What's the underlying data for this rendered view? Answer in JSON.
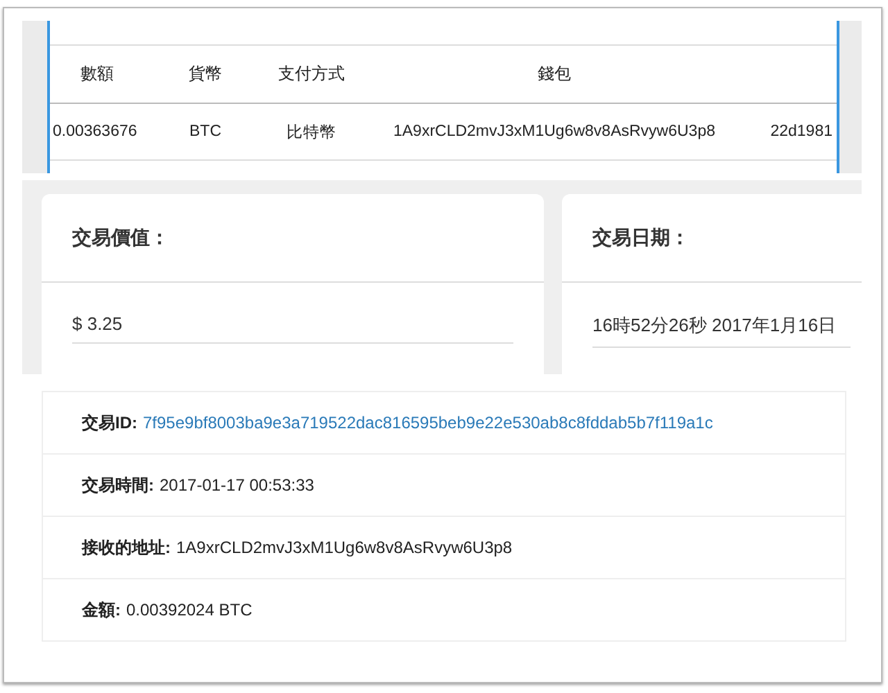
{
  "table": {
    "columns": [
      "數額",
      "貨幣",
      "支付方式",
      "錢包"
    ],
    "rows": [
      [
        "0.00363676",
        "BTC",
        "比特幣",
        "1A9xrCLD2mvJ3xM1Ug6w8v8AsRvyw6U3p8",
        "22d1981"
      ]
    ]
  },
  "cards": [
    {
      "label": "交易價值：",
      "value": "$ 3.25"
    },
    {
      "label": "交易日期：",
      "value": "16時52分26秒 2017年1月16日"
    }
  ],
  "details": [
    {
      "label": "交易ID:",
      "value": "7f95e9bf8003ba9e3a719522dac816595beb9e22e530ab8c8fddab5b7f119a1c",
      "kind": "link"
    },
    {
      "label": "交易時間:",
      "value": "2017-01-17 00:53:33",
      "kind": "text"
    },
    {
      "label": "接收的地址:",
      "value": "1A9xrCLD2mvJ3xM1Ug6w8v8AsRvyw6U3p8",
      "kind": "text"
    },
    {
      "label": "金額:",
      "value": "0.00392024 BTC",
      "kind": "text"
    }
  ]
}
